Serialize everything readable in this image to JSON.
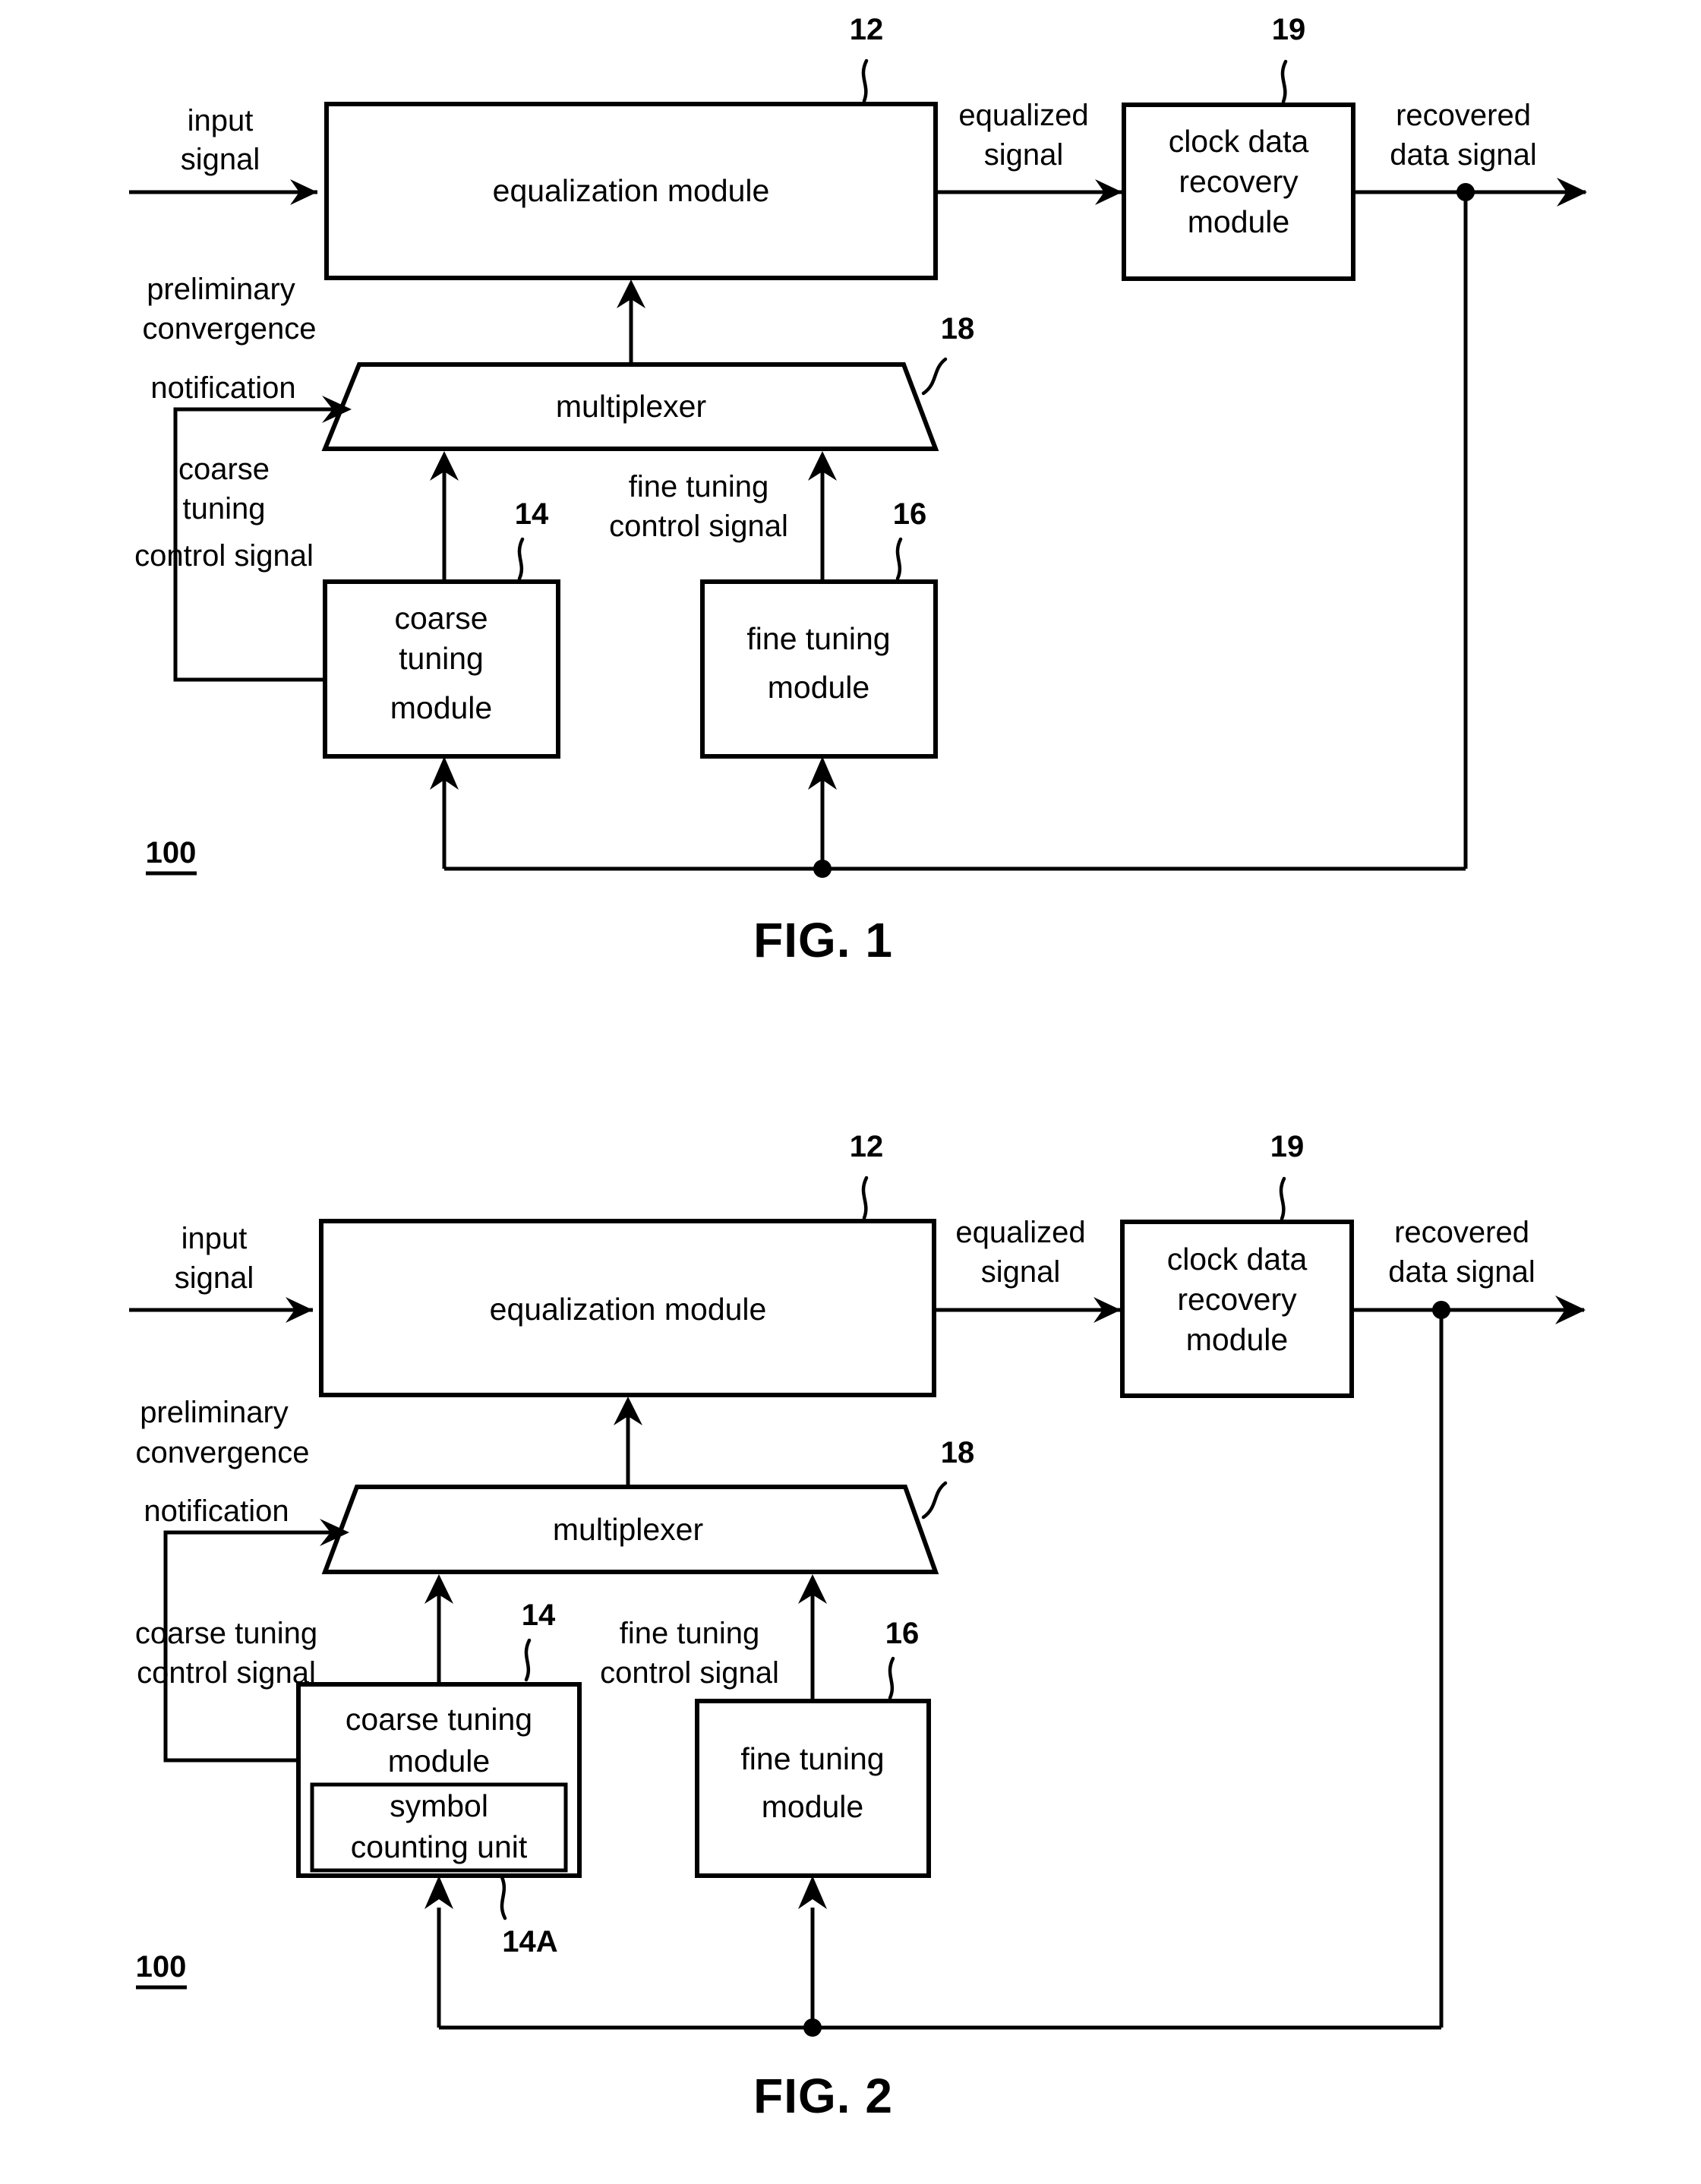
{
  "figures": [
    {
      "id": "fig1",
      "caption": "FIG. 1",
      "system_ref": "100",
      "signals": {
        "input": "input\nsignal",
        "input_line1": "input",
        "input_line2": "signal",
        "equalized_line1": "equalized",
        "equalized_line2": "signal",
        "recovered_line1": "recovered",
        "recovered_line2": "data signal",
        "preliminary_line1": "preliminary",
        "preliminary_line2": "convergence",
        "preliminary_line3": "notification",
        "coarse_ctrl_line1": "coarse",
        "coarse_ctrl_line2": "tuning",
        "coarse_ctrl_line3": "control signal",
        "fine_ctrl_line1": "fine tuning",
        "fine_ctrl_line2": "control signal"
      },
      "blocks": [
        {
          "ref": "12",
          "lines": [
            "equalization module"
          ],
          "name": "equalization-module"
        },
        {
          "ref": "19",
          "lines": [
            "clock data",
            "recovery",
            "module"
          ],
          "name": "clock-data-recovery-module"
        },
        {
          "ref": "18",
          "lines": [
            "multiplexer"
          ],
          "name": "multiplexer"
        },
        {
          "ref": "14",
          "lines": [
            "coarse",
            "tuning",
            "module"
          ],
          "name": "coarse-tuning-module"
        },
        {
          "ref": "16",
          "lines": [
            "fine tuning",
            "module"
          ],
          "name": "fine-tuning-module"
        }
      ]
    },
    {
      "id": "fig2",
      "caption": "FIG. 2",
      "system_ref": "100",
      "signals": {
        "input_line1": "input",
        "input_line2": "signal",
        "equalized_line1": "equalized",
        "equalized_line2": "signal",
        "recovered_line1": "recovered",
        "recovered_line2": "data signal",
        "preliminary_line1": "preliminary",
        "preliminary_line2": "convergence",
        "preliminary_line3": "notification",
        "coarse_ctrl_line1": "coarse tuning",
        "coarse_ctrl_line2": "control signal",
        "fine_ctrl_line1": "fine tuning",
        "fine_ctrl_line2": "control signal"
      },
      "blocks": [
        {
          "ref": "12",
          "lines": [
            "equalization module"
          ],
          "name": "equalization-module"
        },
        {
          "ref": "19",
          "lines": [
            "clock data",
            "recovery",
            "module"
          ],
          "name": "clock-data-recovery-module"
        },
        {
          "ref": "18",
          "lines": [
            "multiplexer"
          ],
          "name": "multiplexer"
        },
        {
          "ref": "14",
          "lines": [
            "coarse tuning",
            "module"
          ],
          "name": "coarse-tuning-module"
        },
        {
          "ref": "14A",
          "lines": [
            "symbol",
            "counting unit"
          ],
          "name": "symbol-counting-unit"
        },
        {
          "ref": "16",
          "lines": [
            "fine tuning",
            "module"
          ],
          "name": "fine-tuning-module"
        }
      ]
    }
  ],
  "fig1": {
    "caption": "FIG. 1",
    "system_ref": "100",
    "eq_label": "equalization module",
    "eq_ref": "12",
    "cdr_l1": "clock data",
    "cdr_l2": "recovery",
    "cdr_l3": "module",
    "cdr_ref": "19",
    "mux_label": "multiplexer",
    "mux_ref": "18",
    "coarse_l1": "coarse",
    "coarse_l2": "tuning",
    "coarse_l3": "module",
    "coarse_ref": "14",
    "fine_l1": "fine tuning",
    "fine_l2": "module",
    "fine_ref": "16",
    "input_l1": "input",
    "input_l2": "signal",
    "eqsig_l1": "equalized",
    "eqsig_l2": "signal",
    "rec_l1": "recovered",
    "rec_l2": "data signal",
    "prelim_l1": "preliminary",
    "prelim_l2": "convergence",
    "prelim_l3": "notification",
    "coarsectl_l1": "coarse",
    "coarsectl_l2": "tuning",
    "coarsectl_l3": "control signal",
    "finectl_l1": "fine tuning",
    "finectl_l2": "control signal"
  },
  "fig2": {
    "caption": "FIG. 2",
    "system_ref": "100",
    "eq_label": "equalization module",
    "eq_ref": "12",
    "cdr_l1": "clock data",
    "cdr_l2": "recovery",
    "cdr_l3": "module",
    "cdr_ref": "19",
    "mux_label": "multiplexer",
    "mux_ref": "18",
    "coarse_l1": "coarse tuning",
    "coarse_l2": "module",
    "coarse_ref": "14",
    "sym_l1": "symbol",
    "sym_l2": "counting unit",
    "sym_ref": "14A",
    "fine_l1": "fine tuning",
    "fine_l2": "module",
    "fine_ref": "16",
    "input_l1": "input",
    "input_l2": "signal",
    "eqsig_l1": "equalized",
    "eqsig_l2": "signal",
    "rec_l1": "recovered",
    "rec_l2": "data signal",
    "prelim_l1": "preliminary",
    "prelim_l2": "convergence",
    "prelim_l3": "notification",
    "coarsectl_l1": "coarse tuning",
    "coarsectl_l2": "control signal",
    "finectl_l1": "fine tuning",
    "finectl_l2": "control signal"
  }
}
